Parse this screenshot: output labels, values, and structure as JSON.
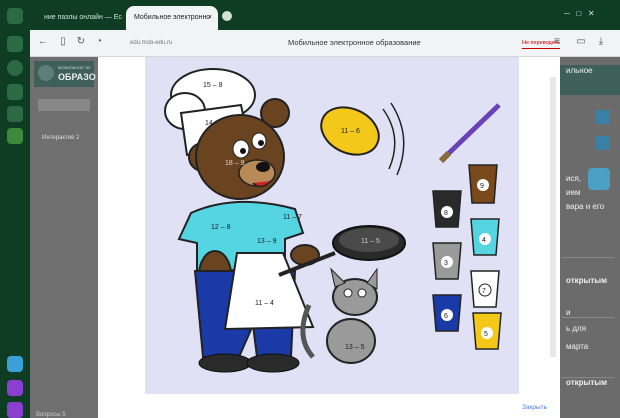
{
  "browser": {
    "tabs": [
      {
        "label": "ние пазлы онлайн — Ес",
        "active": false
      },
      {
        "label": "Мобильное электронно",
        "active": true
      }
    ],
    "url": "edu.mob-edu.ru",
    "page_title": "Мобильное электронное образование",
    "translate_label": "Не переводить"
  },
  "site": {
    "logo_line1": "МОБИЛЬНОЕ ЭЛ",
    "logo_line2": "ОБРАЗО",
    "right_header": "ильное",
    "right_texts": [
      "ися,",
      "ием",
      "вара и его"
    ],
    "right_sections": [
      "открытым",
      "и",
      "ь для",
      "марта",
      "открытым"
    ],
    "left_label": "Интерактив 2",
    "footer_text": "Вопросы 5"
  },
  "exercise": {
    "hat_top": "15 – 8",
    "hat_bottom": "14 – 7",
    "pancake": "11 – 6",
    "face": "18 – 9",
    "shirt_left": "12 – 8",
    "shirt_right": "11 – 7",
    "shirt_mid": "13 – 9",
    "pan": "11 – 5",
    "apron": "11 – 4",
    "cat": "13 – 5",
    "buckets": [
      "9",
      "8",
      "4",
      "3",
      "7",
      "6",
      "5"
    ]
  },
  "modal": {
    "close_label": "Закрыть"
  }
}
